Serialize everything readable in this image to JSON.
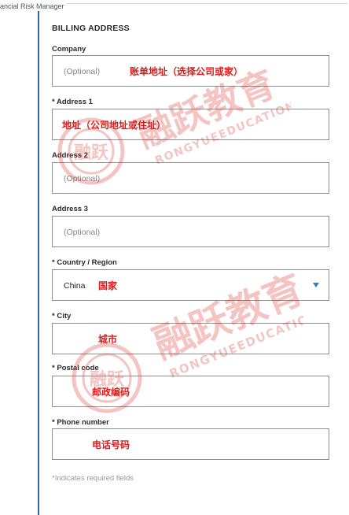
{
  "form": {
    "legend": "ancial Risk Manager",
    "section_title": "BILLING ADDRESS",
    "footnote": "*Indicates required fields"
  },
  "fields": {
    "company": {
      "label": "Company",
      "placeholder": "(Optional)",
      "annotation": "账单地址（选择公司或家）"
    },
    "address1": {
      "label": "* Address 1",
      "annotation": "地址（公司地址或住址）"
    },
    "address2": {
      "label": "Address 2",
      "placeholder": "(Optional)"
    },
    "address3": {
      "label": "Address 3",
      "placeholder": "(Optional)"
    },
    "country": {
      "label": "* Country / Region",
      "value": "China",
      "annotation": "国家"
    },
    "city": {
      "label": "* City",
      "annotation": "城市"
    },
    "postal": {
      "label": "* Postal code",
      "annotation": "邮政编码"
    },
    "phone": {
      "label": "* Phone number",
      "annotation": "电话号码"
    }
  },
  "watermark": {
    "brand_cn": "融跃教育",
    "brand_en": "RONGYUEEDUCATION",
    "seal_text": "融跃"
  },
  "colors": {
    "accent_border": "#2f66ad",
    "annotation": "#e01a1a",
    "watermark": "#d9302c",
    "caret": "#2f7bd1"
  }
}
